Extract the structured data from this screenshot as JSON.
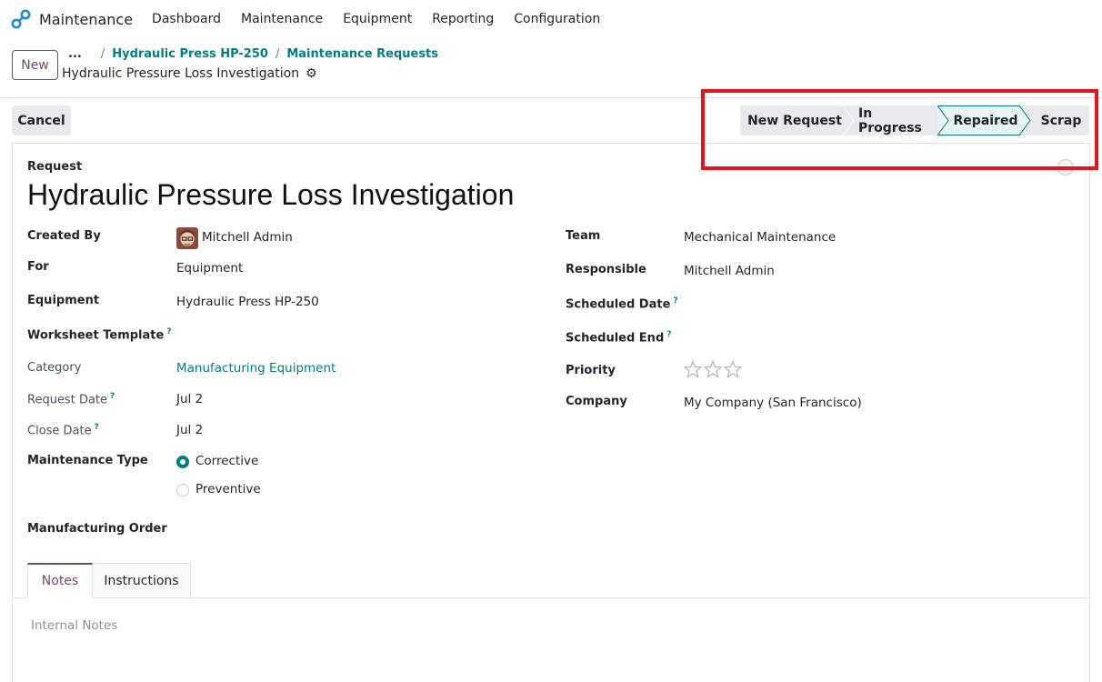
{
  "nav": {
    "app_name": "Maintenance",
    "items": [
      "Dashboard",
      "Maintenance",
      "Equipment",
      "Reporting",
      "Configuration"
    ]
  },
  "control": {
    "new_label": "New",
    "breadcrumb_dots": "...",
    "breadcrumbs": [
      "Hydraulic Press HP-250",
      "Maintenance Requests"
    ],
    "record_title": "Hydraulic Pressure Loss Investigation"
  },
  "actions": {
    "cancel_label": "Cancel"
  },
  "statusbar": {
    "stages": [
      "New Request",
      "In Progress",
      "Repaired",
      "Scrap"
    ],
    "current": "Repaired"
  },
  "form": {
    "header_label": "Request",
    "title": "Hydraulic Pressure Loss Investigation",
    "left": {
      "created_by_label": "Created By",
      "created_by_value": "Mitchell Admin",
      "for_label": "For",
      "for_value": "Equipment",
      "equipment_label": "Equipment",
      "equipment_value": "Hydraulic Press HP-250",
      "worksheet_label": "Worksheet Template",
      "category_label": "Category",
      "category_value": "Manufacturing Equipment",
      "request_date_label": "Request Date",
      "request_date_value": "Jul 2",
      "close_date_label": "Close Date",
      "close_date_value": "Jul 2",
      "maintenance_type_label": "Maintenance Type",
      "maintenance_type_options": [
        "Corrective",
        "Preventive"
      ],
      "maintenance_type_selected": "Corrective",
      "manufacturing_order_label": "Manufacturing Order"
    },
    "right": {
      "team_label": "Team",
      "team_value": "Mechanical Maintenance",
      "responsible_label": "Responsible",
      "responsible_value": "Mitchell Admin",
      "scheduled_date_label": "Scheduled Date",
      "scheduled_end_label": "Scheduled End",
      "priority_label": "Priority",
      "priority_value": 0,
      "priority_max": 3,
      "company_label": "Company",
      "company_value": "My Company (San Francisco)"
    },
    "help_marker": "?"
  },
  "tabs": {
    "items": [
      "Notes",
      "Instructions"
    ],
    "active": "Notes",
    "notes_placeholder": "Internal Notes"
  },
  "colors": {
    "brand": "#714b67",
    "link": "#017e84",
    "highlight": "#e8131a"
  }
}
